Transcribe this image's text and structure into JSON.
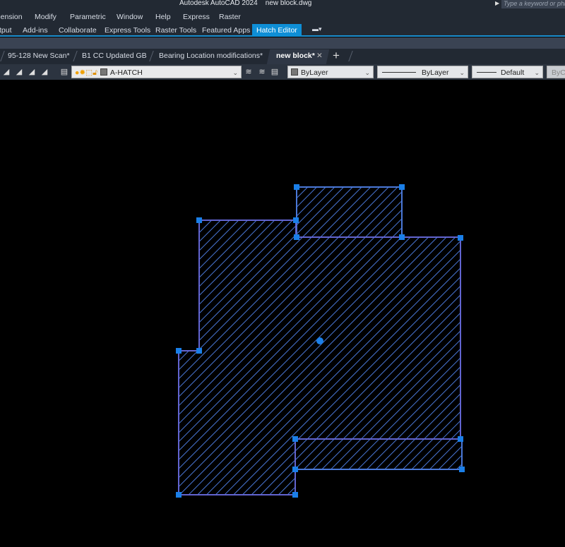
{
  "title": {
    "app": "Autodesk AutoCAD 2024",
    "file": "new block.dwg"
  },
  "search": {
    "placeholder": "Type a keyword or phrase"
  },
  "menu": [
    "Dimension",
    "Modify",
    "Parametric",
    "Window",
    "Help",
    "Express",
    "Raster"
  ],
  "ribbon_tabs": [
    "Output",
    "Add-ins",
    "Collaborate",
    "Express Tools",
    "Raster Tools",
    "Featured Apps",
    "Hatch Editor"
  ],
  "file_tabs": [
    "95-128 New Scan*",
    "B1 CC Updated GB",
    "Bearing Location modifications*",
    "new block*"
  ],
  "toolbar": {
    "layer": "A-HATCH",
    "color": "ByLayer",
    "linetype": "ByLayer",
    "lineweight": "Default",
    "plotstyle": "ByColor"
  },
  "colors": {
    "hatch": "#4a78d8",
    "grip": "#1a7fe8",
    "boundary": "#7a50c8",
    "accent": "#0e8ed6"
  }
}
